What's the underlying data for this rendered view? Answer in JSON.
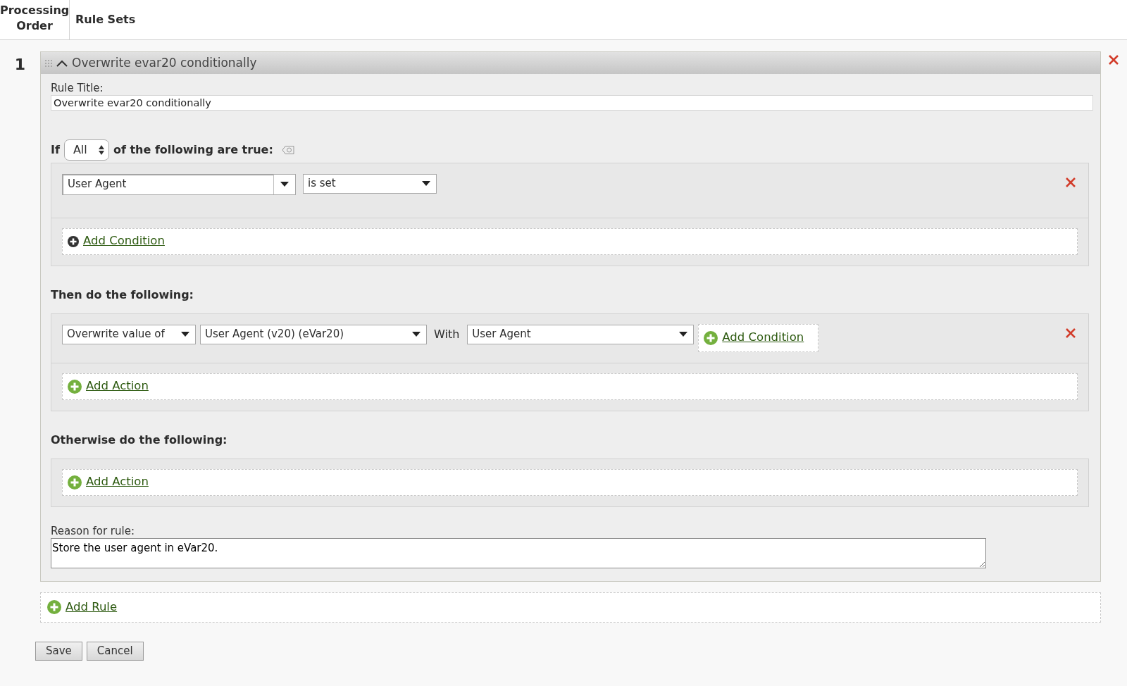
{
  "header": {
    "columns": [
      "Processing Order",
      "Rule Sets"
    ]
  },
  "rules": [
    {
      "number": "1",
      "title": "Overwrite evar20 conditionally",
      "expanded": true,
      "rule_title_label": "Rule Title:",
      "rule_title_value": "Overwrite evar20 conditionally",
      "condition_intro": {
        "prefix": "If",
        "match": "All",
        "suffix": "of the following are true:"
      },
      "conditions": [
        {
          "field": "User Agent",
          "operator": "is set"
        }
      ],
      "add_condition": "Add Condition",
      "then_label": "Then do the following:",
      "actions": [
        {
          "action": "Overwrite value of",
          "target": "User Agent (v20) (eVar20)",
          "with_label": "With",
          "value": "User Agent",
          "add_condition": "Add Condition"
        }
      ],
      "add_action": "Add Action",
      "otherwise_label": "Otherwise do the following:",
      "otherwise_add_action": "Add Action",
      "reason_label": "Reason for rule:",
      "reason": "Store the user agent in eVar20."
    }
  ],
  "add_rule": "Add Rule",
  "buttons": [
    "Save",
    "Cancel"
  ]
}
